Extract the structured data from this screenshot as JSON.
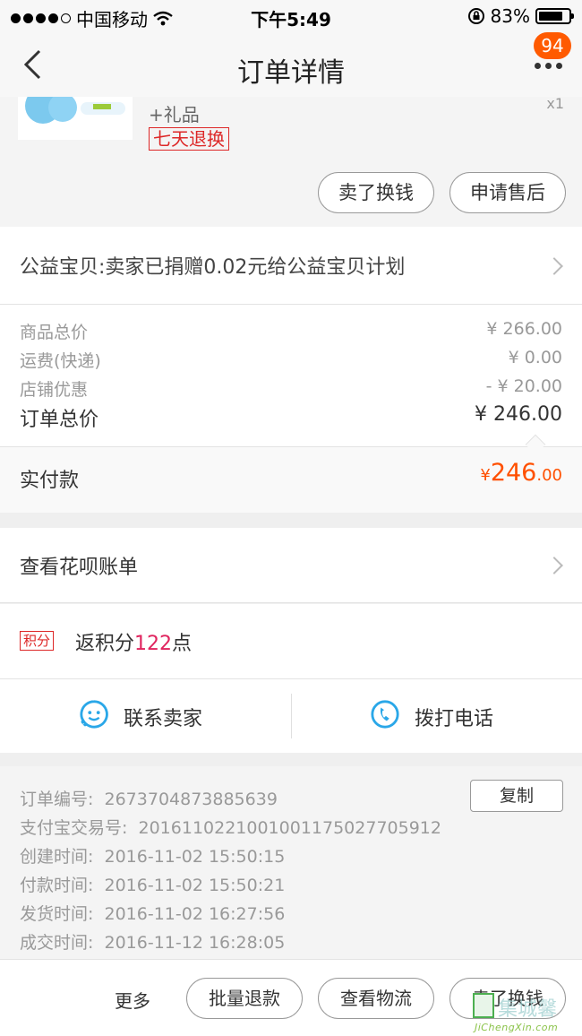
{
  "status_bar": {
    "carrier": "中国移动",
    "time": "下午5:49",
    "battery_text": "83%",
    "battery_level": 0.83
  },
  "nav": {
    "title": "订单详情",
    "badge": "94"
  },
  "product": {
    "gift": "+礼品",
    "return_tag": "七天退换",
    "qty": "x1",
    "buttons": [
      "卖了换钱",
      "申请售后"
    ]
  },
  "charity": {
    "text": "公益宝贝:卖家已捐赠0.02元给公益宝贝计划"
  },
  "prices": {
    "rows": [
      {
        "label": "商品总价",
        "value": "¥ 266.00"
      },
      {
        "label": "运费(快递)",
        "value": "¥ 0.00"
      },
      {
        "label": "店铺优惠",
        "value": "- ¥ 20.00"
      }
    ],
    "total": {
      "label": "订单总价",
      "value": "¥ 246.00"
    }
  },
  "paid": {
    "label": "实付款",
    "currency": "¥",
    "integer": "246",
    "decimal": ".00"
  },
  "huabei": {
    "text": "查看花呗账单"
  },
  "points": {
    "tag": "积分",
    "prefix": "返积分",
    "num": "122",
    "suffix": "点"
  },
  "contact": {
    "seller": "联系卖家",
    "phone": "拨打电话"
  },
  "info": {
    "copy": "复制",
    "rows": [
      {
        "label": "订单编号:",
        "value": "2673704873885639"
      },
      {
        "label": "支付宝交易号:",
        "value": "2016110221001001175027705912"
      },
      {
        "label": "创建时间:",
        "value": "2016-11-02 15:50:15"
      },
      {
        "label": "付款时间:",
        "value": "2016-11-02 15:50:21"
      },
      {
        "label": "发货时间:",
        "value": "2016-11-02 16:27:56"
      },
      {
        "label": "成交时间:",
        "value": "2016-11-12 16:28:05"
      }
    ]
  },
  "bottom": {
    "more": "更多",
    "buttons": [
      "批量退款",
      "查看物流",
      "卖了换钱"
    ]
  },
  "watermark": {
    "text": "集城馨",
    "url": "JiChengXin.com"
  },
  "colors": {
    "accent": "#ff5000",
    "tag_red": "#dd2727",
    "points_pink": "#e0245e",
    "icon_blue": "#2aa7e8"
  }
}
